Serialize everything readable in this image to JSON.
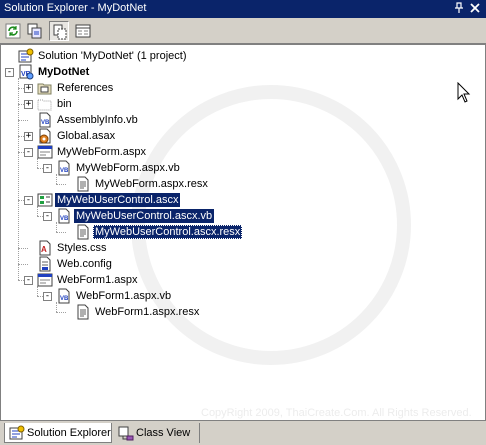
{
  "window": {
    "title": "Solution Explorer - MyDotNet",
    "pin_glyph": "📌",
    "close_glyph": "✕"
  },
  "toolbar": [
    {
      "icon": "refresh-icon"
    },
    {
      "icon": "copy-project-icon"
    },
    {
      "icon": "show-all-files-icon",
      "pressed": true
    },
    {
      "icon": "properties-icon"
    }
  ],
  "tree": [
    {
      "label": "Solution 'MyDotNet' (1 project)",
      "icon": "solution-icon",
      "expander": "",
      "depth": 0
    },
    {
      "label": "MyDotNet",
      "icon": "vb-project-icon",
      "expander": "-",
      "depth": 0,
      "bold": true
    },
    {
      "label": "References",
      "icon": "references-folder-icon",
      "expander": "+",
      "depth": 1
    },
    {
      "label": "bin",
      "icon": "folder-outline-icon",
      "expander": "+",
      "depth": 1
    },
    {
      "label": "AssemblyInfo.vb",
      "icon": "vb-file-icon",
      "expander": "",
      "depth": 1
    },
    {
      "label": "Global.asax",
      "icon": "global-asax-icon",
      "expander": "+",
      "depth": 1
    },
    {
      "label": "MyWebForm.aspx",
      "icon": "webform-icon",
      "expander": "-",
      "depth": 1
    },
    {
      "label": "MyWebForm.aspx.vb",
      "icon": "vb-file-icon",
      "expander": "-",
      "depth": 2
    },
    {
      "label": "MyWebForm.aspx.resx",
      "icon": "resx-file-icon",
      "expander": "",
      "depth": 3
    },
    {
      "label": "MyWebUserControl.ascx",
      "icon": "user-control-icon",
      "expander": "-",
      "depth": 1,
      "selected": true
    },
    {
      "label": "MyWebUserControl.ascx.vb",
      "icon": "vb-file-icon",
      "expander": "-",
      "depth": 2,
      "selected": true
    },
    {
      "label": "MyWebUserControl.ascx.resx",
      "icon": "resx-file-icon",
      "expander": "",
      "depth": 3,
      "selected": true,
      "focused": true
    },
    {
      "label": "Styles.css",
      "icon": "css-file-icon",
      "expander": "",
      "depth": 1
    },
    {
      "label": "Web.config",
      "icon": "config-file-icon",
      "expander": "",
      "depth": 1
    },
    {
      "label": "WebForm1.aspx",
      "icon": "webform-icon",
      "expander": "-",
      "depth": 1
    },
    {
      "label": "WebForm1.aspx.vb",
      "icon": "vb-file-icon",
      "expander": "-",
      "depth": 2
    },
    {
      "label": "WebForm1.aspx.resx",
      "icon": "resx-file-icon",
      "expander": "",
      "depth": 3
    }
  ],
  "watermark": {
    "copyright": "CopyRight 2009, ThaiCreate.Com. All Rights Reserved."
  },
  "tabs": [
    {
      "label": "Solution Explorer",
      "icon": "solution-explorer-icon",
      "active": true
    },
    {
      "label": "Class View",
      "icon": "class-view-icon",
      "active": false
    }
  ],
  "colors": {
    "selection": "#0a246a",
    "titlebar": "#0a246a",
    "chrome": "#d4d0c8",
    "tree_lines": "#a0a0a0"
  }
}
